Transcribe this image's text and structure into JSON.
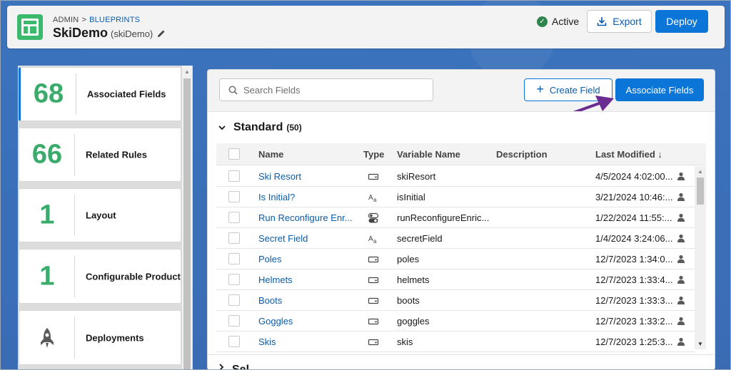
{
  "header": {
    "breadcrumb": [
      "ADMIN",
      "BLUEPRINTS"
    ],
    "breadcrumb_sep": ">",
    "title": "SkiDemo",
    "subtitle": "(skiDemo)",
    "status": "Active",
    "export_label": "Export",
    "deploy_label": "Deploy"
  },
  "sidebar": {
    "cards": [
      {
        "count": "68",
        "label": "Associated Fields",
        "active": true
      },
      {
        "count": "66",
        "label": "Related Rules"
      },
      {
        "count": "1",
        "label": "Layout"
      },
      {
        "count": "1",
        "label": "Configurable Product"
      },
      {
        "count": "",
        "label": "Deployments",
        "icon": "rocket-icon"
      }
    ]
  },
  "toolbar": {
    "search_placeholder": "Search Fields",
    "create_label": "Create Field",
    "associate_label": "Associate Fields"
  },
  "section": {
    "title": "Standard",
    "count": "(50)",
    "next_title": "Sel..."
  },
  "table": {
    "columns": {
      "name": "Name",
      "type": "Type",
      "variable": "Variable Name",
      "description": "Description",
      "modified": "Last Modified"
    },
    "sort_indicator": "↓",
    "rows": [
      {
        "name": "Ski Resort",
        "type": "picklist",
        "variable": "skiResort",
        "modified": "4/5/2024 4:02:00..."
      },
      {
        "name": "Is Initial?",
        "type": "text",
        "variable": "isInitial",
        "modified": "3/21/2024 10:46:..."
      },
      {
        "name": "Run Reconfigure Enr...",
        "type": "toggle",
        "variable": "runReconfigureEnric...",
        "modified": "1/22/2024 11:55:..."
      },
      {
        "name": "Secret Field",
        "type": "text",
        "variable": "secretField",
        "modified": "1/4/2024 3:24:06..."
      },
      {
        "name": "Poles",
        "type": "picklist",
        "variable": "poles",
        "modified": "12/7/2023 1:34:0..."
      },
      {
        "name": "Helmets",
        "type": "picklist",
        "variable": "helmets",
        "modified": "12/7/2023 1:33:4..."
      },
      {
        "name": "Boots",
        "type": "picklist",
        "variable": "boots",
        "modified": "12/7/2023 1:33:3..."
      },
      {
        "name": "Goggles",
        "type": "picklist",
        "variable": "goggles",
        "modified": "12/7/2023 1:33:2..."
      },
      {
        "name": "Skis",
        "type": "picklist",
        "variable": "skis",
        "modified": "12/7/2023 1:25:3..."
      }
    ]
  },
  "colors": {
    "brand_green": "#3bab6c",
    "primary_blue": "#0b76d8",
    "link_blue": "#0b5cab",
    "annotation_purple": "#6b2c91",
    "success_green": "#2e844a"
  }
}
